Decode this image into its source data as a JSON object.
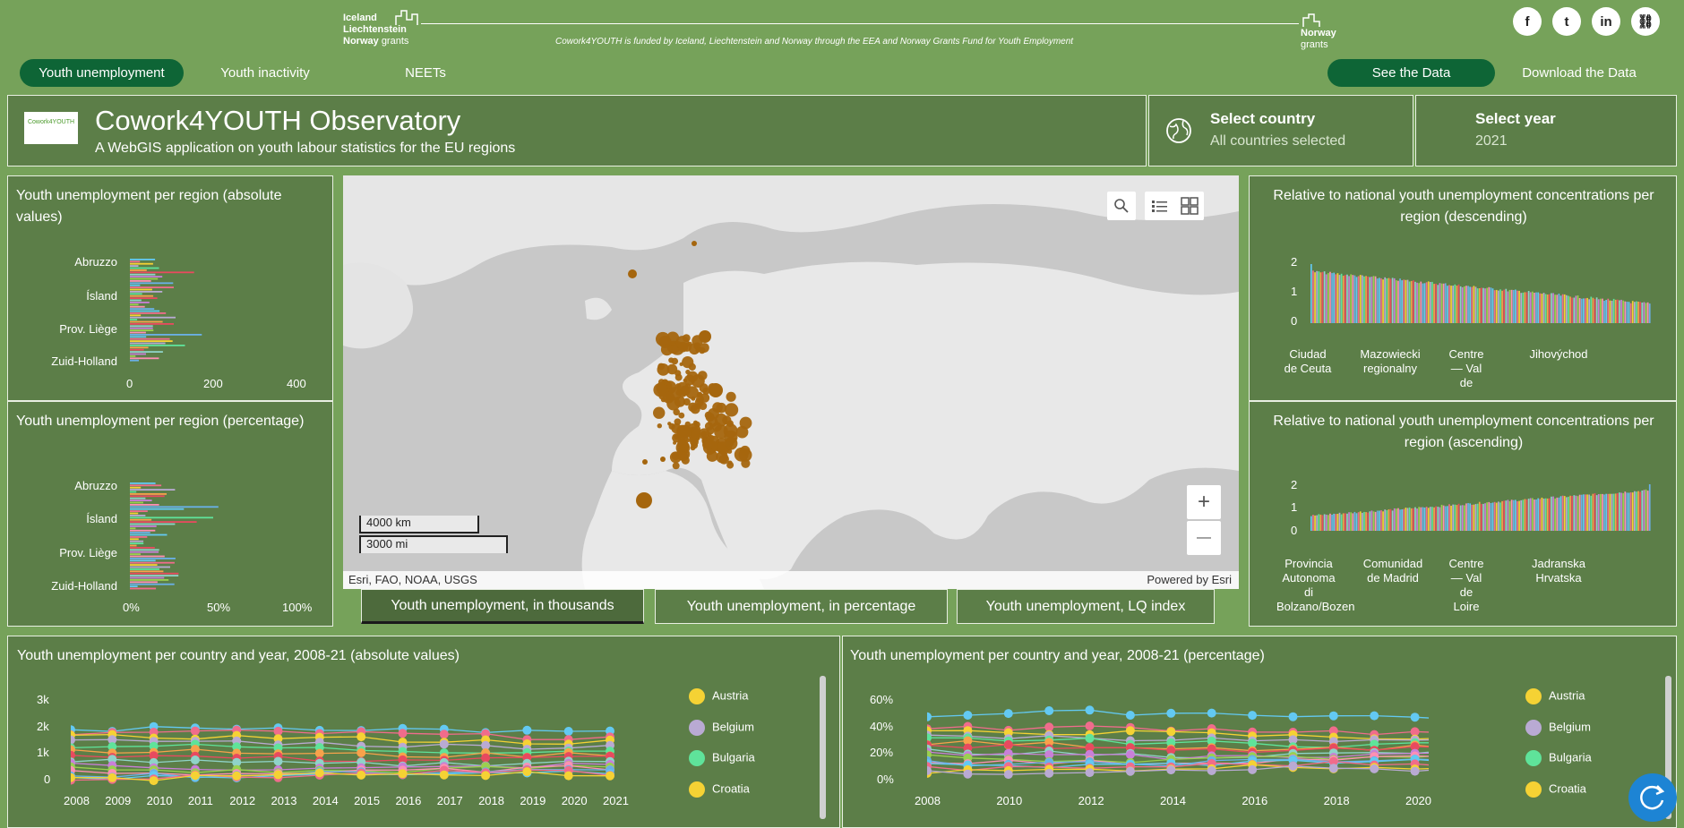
{
  "grants": {
    "logo_lines": [
      "Iceland",
      "Liechtenstein",
      "Norway"
    ],
    "logo_suffix": "grants",
    "funding_text": "Cowork4YOUTH is funded by Iceland, Liechtenstein and Norway through the EEA and Norway Grants Fund for Youth Employment",
    "norway_line": "Norway",
    "norway_suffix": "grants"
  },
  "social": [
    {
      "name": "facebook-icon",
      "glyph": "f"
    },
    {
      "name": "twitter-icon",
      "glyph": "t"
    },
    {
      "name": "linkedin-icon",
      "glyph": "in"
    },
    {
      "name": "link-icon",
      "glyph": "⛓"
    }
  ],
  "nav": {
    "tabs": [
      "Youth unemployment",
      "Youth inactivity",
      "NEETs"
    ],
    "active": "Youth unemployment",
    "see_data": "See the Data",
    "download_data": "Download the Data"
  },
  "header": {
    "logo_text": "Cowork4YOUTH",
    "title": "Cowork4YOUTH Observatory",
    "subtitle": "A WebGIS application on youth labour statistics for the EU regions",
    "country_label": "Select country",
    "country_value": "All countries selected",
    "year_label": "Select year",
    "year_value": "2021"
  },
  "left_top": {
    "title": "Youth unemployment per region (absolute values)",
    "categories": [
      "Abruzzo",
      "Ísland",
      "Prov. Liège",
      "Zuid-Holland"
    ],
    "ticks": [
      "0",
      "200",
      "400"
    ]
  },
  "left_bottom": {
    "title": "Youth unemployment per region (percentage)",
    "categories": [
      "Abruzzo",
      "Ísland",
      "Prov. Liège",
      "Zuid-Holland"
    ],
    "ticks": [
      "0%",
      "50%",
      "100%"
    ]
  },
  "right_top": {
    "title": "Relative to national youth unemployment concentrations per region (descending)",
    "yticks": [
      "2",
      "1",
      "0"
    ],
    "labels": [
      "Ciudad de Ceuta",
      "Mazowiecki regionalny",
      "Centre — Val de",
      "Jihovýchod"
    ]
  },
  "right_bottom": {
    "title": "Relative to national youth unemployment concentrations per region (ascending)",
    "yticks": [
      "2",
      "1",
      "0"
    ],
    "labels": [
      "Provincia Autonoma di Bolzano/Bozen",
      "Comunidad de Madrid",
      "Centre — Val de Loire",
      "Jadranska Hrvatska"
    ]
  },
  "map": {
    "scale_km": "4000 km",
    "scale_mi": "3000 mi",
    "attribution": "Esri, FAO, NOAA, USGS",
    "powered": "Powered by Esri",
    "zoom_in": "+",
    "zoom_out": "—"
  },
  "map_tabs": [
    "Youth unemployment, in thousands",
    "Youth unemployment, in percentage",
    "Youth unemployment, LQ index"
  ],
  "bottom_left": {
    "title": "Youth unemployment per country and year, 2008-21 (absolute values)",
    "yticks": [
      "3k",
      "2k",
      "1k",
      "0"
    ],
    "xticks": [
      "2008",
      "2009",
      "2010",
      "2011",
      "2012",
      "2013",
      "2014",
      "2015",
      "2016",
      "2017",
      "2018",
      "2019",
      "2020",
      "2021"
    ]
  },
  "bottom_right": {
    "title": "Youth unemployment per country and year, 2008-21 (percentage)",
    "yticks": [
      "60%",
      "40%",
      "20%",
      "0%"
    ],
    "xticks": [
      "2008",
      "2010",
      "2012",
      "2014",
      "2016",
      "2018",
      "2020"
    ]
  },
  "legend": [
    {
      "label": "Austria",
      "color": "#f5d234"
    },
    {
      "label": "Belgium",
      "color": "#b9aad3"
    },
    {
      "label": "Bulgaria",
      "color": "#5fe39a"
    },
    {
      "label": "Croatia",
      "color": "#f5d234"
    }
  ],
  "colors": {
    "background": "#76a25a",
    "panel": "#5c7e48",
    "accent": "#0e6536",
    "map_points": "#a5660e"
  }
}
